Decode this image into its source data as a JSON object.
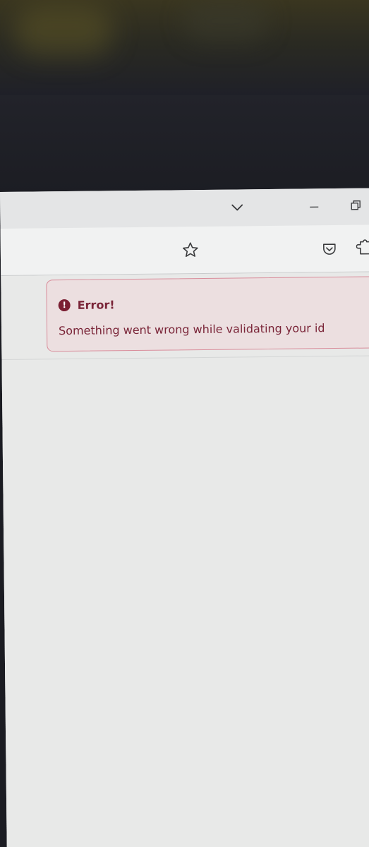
{
  "alert": {
    "title": "Error!",
    "message": "Something went wrong while validating your id",
    "icon": "exclamation-circle-icon",
    "icon_glyph": "!",
    "colors": {
      "border": "#d98d9b",
      "background": "#ecdfe0",
      "text": "#7a2538"
    }
  },
  "browser": {
    "titlebar_icons": [
      "chevron-down-icon",
      "minimize-icon",
      "restore-icon"
    ],
    "toolbar_icons": [
      "star-icon",
      "pocket-icon",
      "extensions-icon"
    ]
  }
}
